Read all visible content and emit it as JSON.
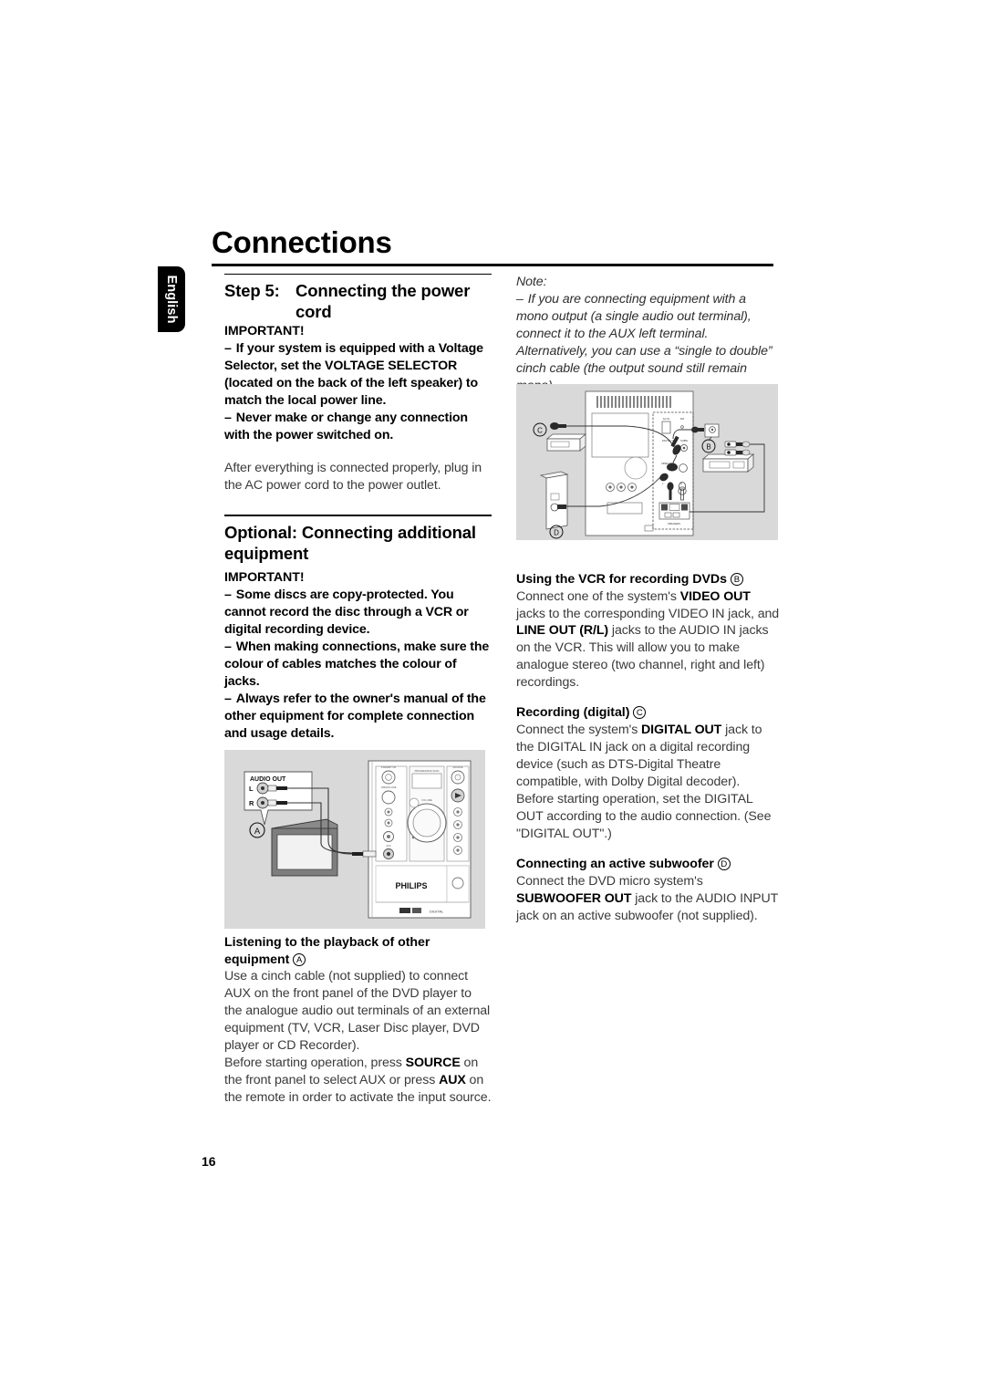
{
  "document": {
    "title": "Connections",
    "language_tab": "English",
    "page_number": "16"
  },
  "left_column": {
    "step_heading": {
      "label": "Step 5:",
      "text": "Connecting the power cord"
    },
    "important_1": {
      "title": "IMPORTANT!",
      "bullets": [
        "If your system is equipped with a Voltage Selector, set the VOLTAGE SELECTOR (located on the back of the left speaker) to match the local power line.",
        "Never make or change any connection with the power switched on."
      ],
      "paragraph": "After everything is connected properly, plug in the AC power cord to the power outlet."
    },
    "optional_heading": "Optional: Connecting additional equipment",
    "important_2": {
      "title": "IMPORTANT!",
      "bullets": [
        "Some discs are copy-protected. You cannot record the disc through a VCR or digital recording device.",
        "When making connections, make sure the colour of cables matches the colour of jacks.",
        "Always refer to the owner's manual of the other equipment for complete connection and usage details."
      ]
    },
    "listening": {
      "heading_line1": "Listening to the playback of other",
      "heading_line2": "equipment",
      "marker": "A",
      "paragraph_1": "Use a cinch cable (not supplied) to connect AUX on the front panel of the DVD player to the analogue audio out terminals of an external equipment (TV, VCR, Laser Disc player, DVD player or CD Recorder).",
      "paragraph_2_pre": "Before starting operation, press ",
      "paragraph_2_b1": "SOURCE",
      "paragraph_2_mid": " on the front panel to select AUX or press ",
      "paragraph_2_b2": "AUX",
      "paragraph_2_post": " on the remote in order to activate the input source."
    }
  },
  "right_column": {
    "note": {
      "label": "Note:",
      "text": "If you are connecting equipment with a mono output (a single audio out terminal), connect it to the AUX left terminal. Alternatively, you can use a “single to double” cinch cable (the output sound still remain mono)."
    },
    "vcr": {
      "heading": "Using the VCR for recording DVDs",
      "marker": "B",
      "pre": "Connect one of the system's ",
      "b1": "VIDEO OUT",
      "mid": " jacks to the corresponding VIDEO IN jack, and ",
      "b2": "LINE OUT (R/L)",
      "post": " jacks to the AUDIO IN jacks on the VCR. This will allow you to make analogue stereo (two channel, right and left) recordings."
    },
    "digital": {
      "heading": "Recording (digital)",
      "marker": "C",
      "pre": "Connect the system's ",
      "b1": "DIGITAL OUT",
      "post": " jack to the DIGITAL IN jack on a digital recording device (such as DTS-Digital Theatre compatible, with Dolby Digital decoder).",
      "paragraph_2": "Before starting operation, set the DIGITAL OUT according to the audio connection. (See \"DIGITAL OUT\".)"
    },
    "subwoofer": {
      "heading": "Connecting an active subwoofer",
      "marker": "D",
      "pre": "Connect the DVD micro system's ",
      "b1": "SUBWOOFER OUT",
      "post": " jack to the AUDIO INPUT jack on an active subwoofer (not supplied)."
    }
  },
  "figures": {
    "top": {
      "name": "rear-panel-connection-diagram",
      "markers": [
        "B",
        "C",
        "D"
      ]
    },
    "bottom": {
      "name": "aux-front-panel-connection-diagram",
      "marker": "A",
      "labels": {
        "audio_out": "AUDIO OUT",
        "left": "L",
        "right": "R",
        "brand": "PHILIPS"
      }
    }
  },
  "colors": {
    "figure_background": "#d9d9d9",
    "body_text": "#3a3a3a",
    "heading_text": "#000000",
    "tab_background": "#000000"
  }
}
